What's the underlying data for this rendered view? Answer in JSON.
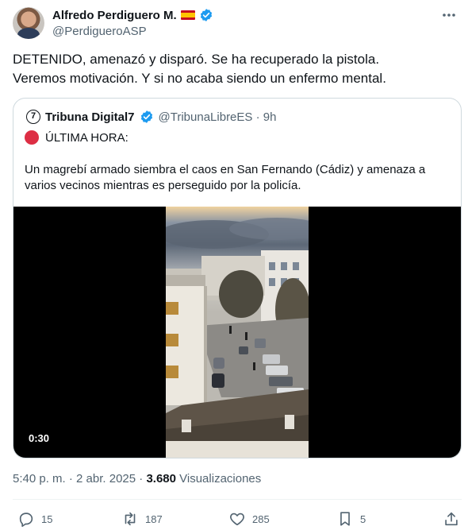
{
  "author": {
    "name": "Alfredo Perdiguero M.",
    "handle": "@PerdigueroASP",
    "flag_icon": "spain-flag-icon",
    "verified_color": "#1d9bf0"
  },
  "tweet": {
    "lines": [
      "DETENIDO, amenazó y disparó. Se ha recuperado la pistola.",
      "Veremos motivación. Y si no acaba siendo un enfermo mental."
    ]
  },
  "quote": {
    "avatar_glyph": "7",
    "name": "Tribuna Digital7",
    "handle_time": "@TribunaLibreES · 9h",
    "headline": "ÚLTIMA HORA:",
    "body_lines": [
      "Un magrebí armado siembra el caos en San Fernando (Cádiz) y amenaza a",
      "varios vecinos mientras es perseguido por la policía."
    ],
    "video_duration": "0:30"
  },
  "meta": {
    "timestamp": "5:40 p. m. · 2 abr. 2025 · ",
    "views_count": "3.680",
    "views_label": " Visualizaciones"
  },
  "actions": {
    "replies": "15",
    "reposts": "187",
    "likes": "285",
    "bookmarks": "5"
  }
}
